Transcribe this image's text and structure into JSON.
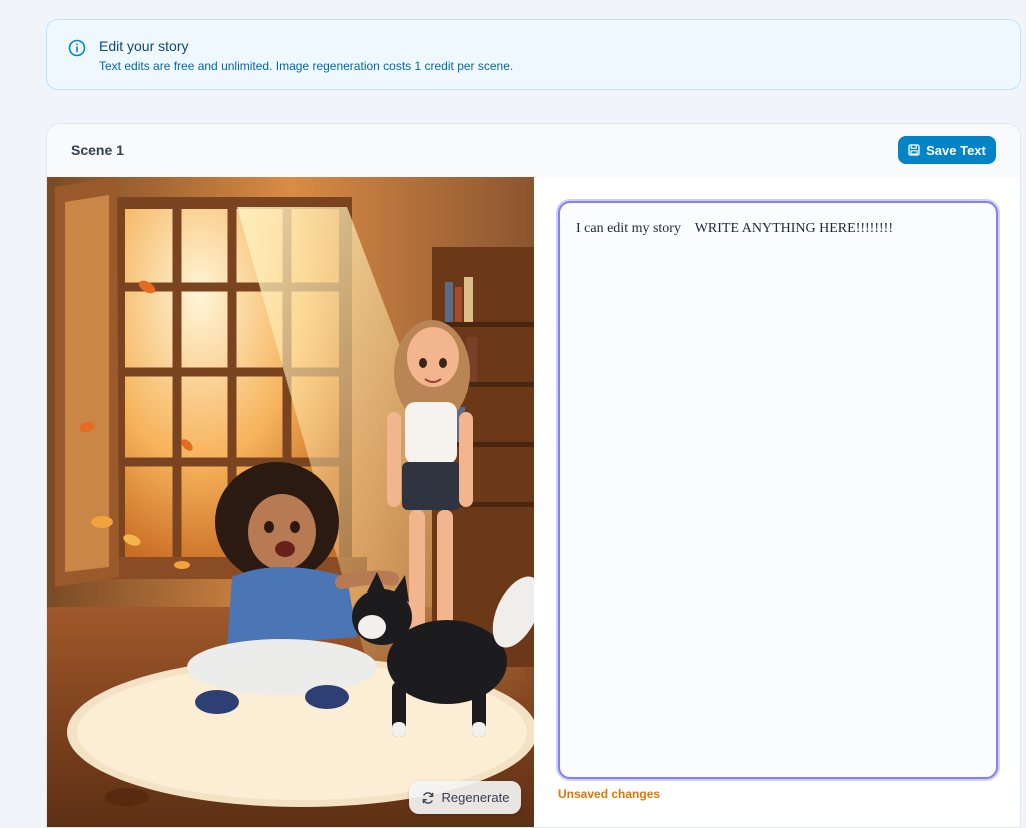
{
  "banner": {
    "title": "Edit your story",
    "subtitle": "Text edits are free and unlimited. Image regeneration costs 1 credit per scene.",
    "icon": "info-icon"
  },
  "scene": {
    "title": "Scene 1",
    "save_label": "Save Text",
    "regenerate_label": "Regenerate",
    "story_text": "I can edit my story    WRITE ANYTHING HERE!!!!!!!!",
    "unsaved_label": "Unsaved changes"
  },
  "colors": {
    "accent": "#0284c7",
    "warning": "#d97706",
    "focus": "#8b7cf0"
  }
}
